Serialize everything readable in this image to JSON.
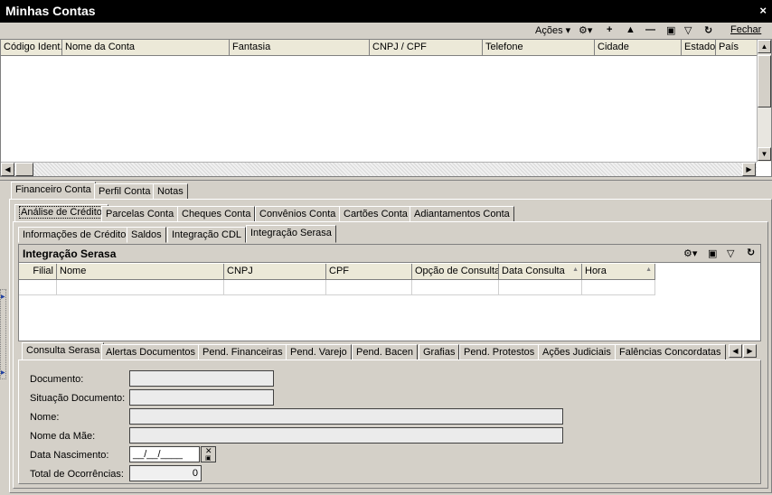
{
  "window": {
    "title": "Minhas Contas",
    "close": "×"
  },
  "toolbar": {
    "acoes_label": "Ações",
    "acoes_arrow": "▾",
    "fechar_label": "Fechar"
  },
  "grid_contas": {
    "columns": [
      "Código Ident.",
      "Nome da Conta",
      "Fantasia",
      "CNPJ / CPF",
      "Telefone",
      "Cidade",
      "Estado",
      "País"
    ]
  },
  "tabs_level1": [
    "Financeiro Conta",
    "Perfil Conta",
    "Notas"
  ],
  "tabs_level2": [
    "Análise de Crédito",
    "Parcelas Conta",
    "Cheques Conta",
    "Convênios Conta",
    "Cartões Conta",
    "Adiantamentos Conta"
  ],
  "tabs_level3": [
    "Informações de Crédito",
    "Saldos",
    "Integração CDL",
    "Integração Serasa"
  ],
  "serasa_panel": {
    "title": "Integração Serasa",
    "columns": [
      "Filial",
      "Nome",
      "CNPJ",
      "CPF",
      "Opção de Consulta",
      "Data Consulta",
      "Hora"
    ]
  },
  "tabs_level4": [
    "Consulta Serasa",
    "Alertas Documentos",
    "Pend. Financeiras",
    "Pend. Varejo",
    "Pend. Bacen",
    "Grafias",
    "Pend. Protestos",
    "Ações Judiciais",
    "Falências Concordatas"
  ],
  "form": {
    "documento_label": "Documento:",
    "situacao_label": "Situação Documento:",
    "nome_label": "Nome:",
    "nome_mae_label": "Nome da Mãe:",
    "data_nasc_label": "Data Nascimento:",
    "data_nasc_value": "__/__/____",
    "total_label": "Total de Ocorrências:",
    "total_value": "0"
  }
}
